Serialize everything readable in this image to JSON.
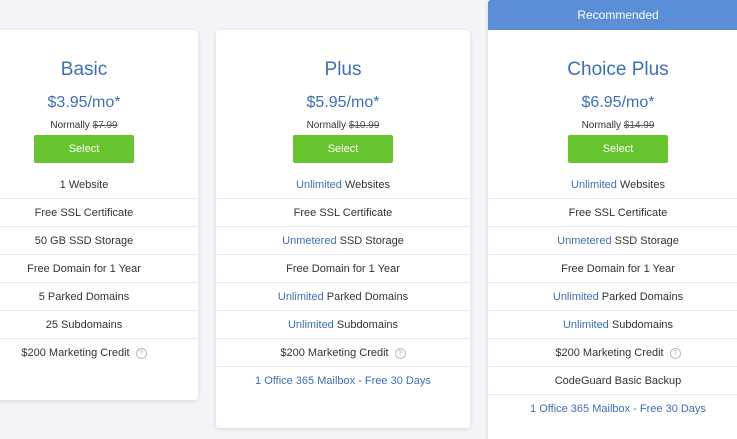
{
  "colors": {
    "accent_blue": "#3d6fb6",
    "ribbon_blue": "#5a8fd7",
    "select_green": "#66c52e"
  },
  "plans": [
    {
      "name": "Basic",
      "price": "$3.95/mo*",
      "normally_label": "Normally",
      "normally_price": "$7.99",
      "select_label": "Select",
      "features": [
        {
          "hl": "",
          "text": "1 Website"
        },
        {
          "hl": "",
          "text": "Free SSL Certificate"
        },
        {
          "hl": "",
          "text": "50 GB SSD Storage"
        },
        {
          "hl": "",
          "text": "Free Domain for 1 Year"
        },
        {
          "hl": "",
          "text": "5 Parked Domains"
        },
        {
          "hl": "",
          "text": "25 Subdomains"
        },
        {
          "hl": "",
          "text": "$200 Marketing Credit",
          "info_icon": "question-icon"
        }
      ]
    },
    {
      "name": "Plus",
      "price": "$5.95/mo*",
      "normally_label": "Normally",
      "normally_price": "$10.99",
      "select_label": "Select",
      "features": [
        {
          "hl": "Unlimited",
          "text": " Websites"
        },
        {
          "hl": "",
          "text": "Free SSL Certificate"
        },
        {
          "hl": "Unmetered",
          "text": " SSD Storage"
        },
        {
          "hl": "",
          "text": "Free Domain for 1 Year"
        },
        {
          "hl": "Unlimited",
          "text": " Parked Domains"
        },
        {
          "hl": "Unlimited",
          "text": " Subdomains"
        },
        {
          "hl": "",
          "text": "$200 Marketing Credit",
          "info_icon": "question-icon"
        },
        {
          "link": "1 Office 365 Mailbox - Free 30 Days"
        }
      ]
    },
    {
      "ribbon": "Recommended",
      "name": "Choice Plus",
      "price": "$6.95/mo*",
      "normally_label": "Normally",
      "normally_price": "$14.99",
      "select_label": "Select",
      "features": [
        {
          "hl": "Unlimited",
          "text": " Websites"
        },
        {
          "hl": "",
          "text": "Free SSL Certificate"
        },
        {
          "hl": "Unmetered",
          "text": " SSD Storage"
        },
        {
          "hl": "",
          "text": "Free Domain for 1 Year"
        },
        {
          "hl": "Unlimited",
          "text": " Parked Domains"
        },
        {
          "hl": "Unlimited",
          "text": " Subdomains"
        },
        {
          "hl": "",
          "text": "$200 Marketing Credit",
          "info_icon": "question-icon"
        },
        {
          "hl": "",
          "text": "CodeGuard Basic Backup"
        },
        {
          "link": "1 Office 365 Mailbox - Free 30 Days"
        }
      ]
    }
  ]
}
